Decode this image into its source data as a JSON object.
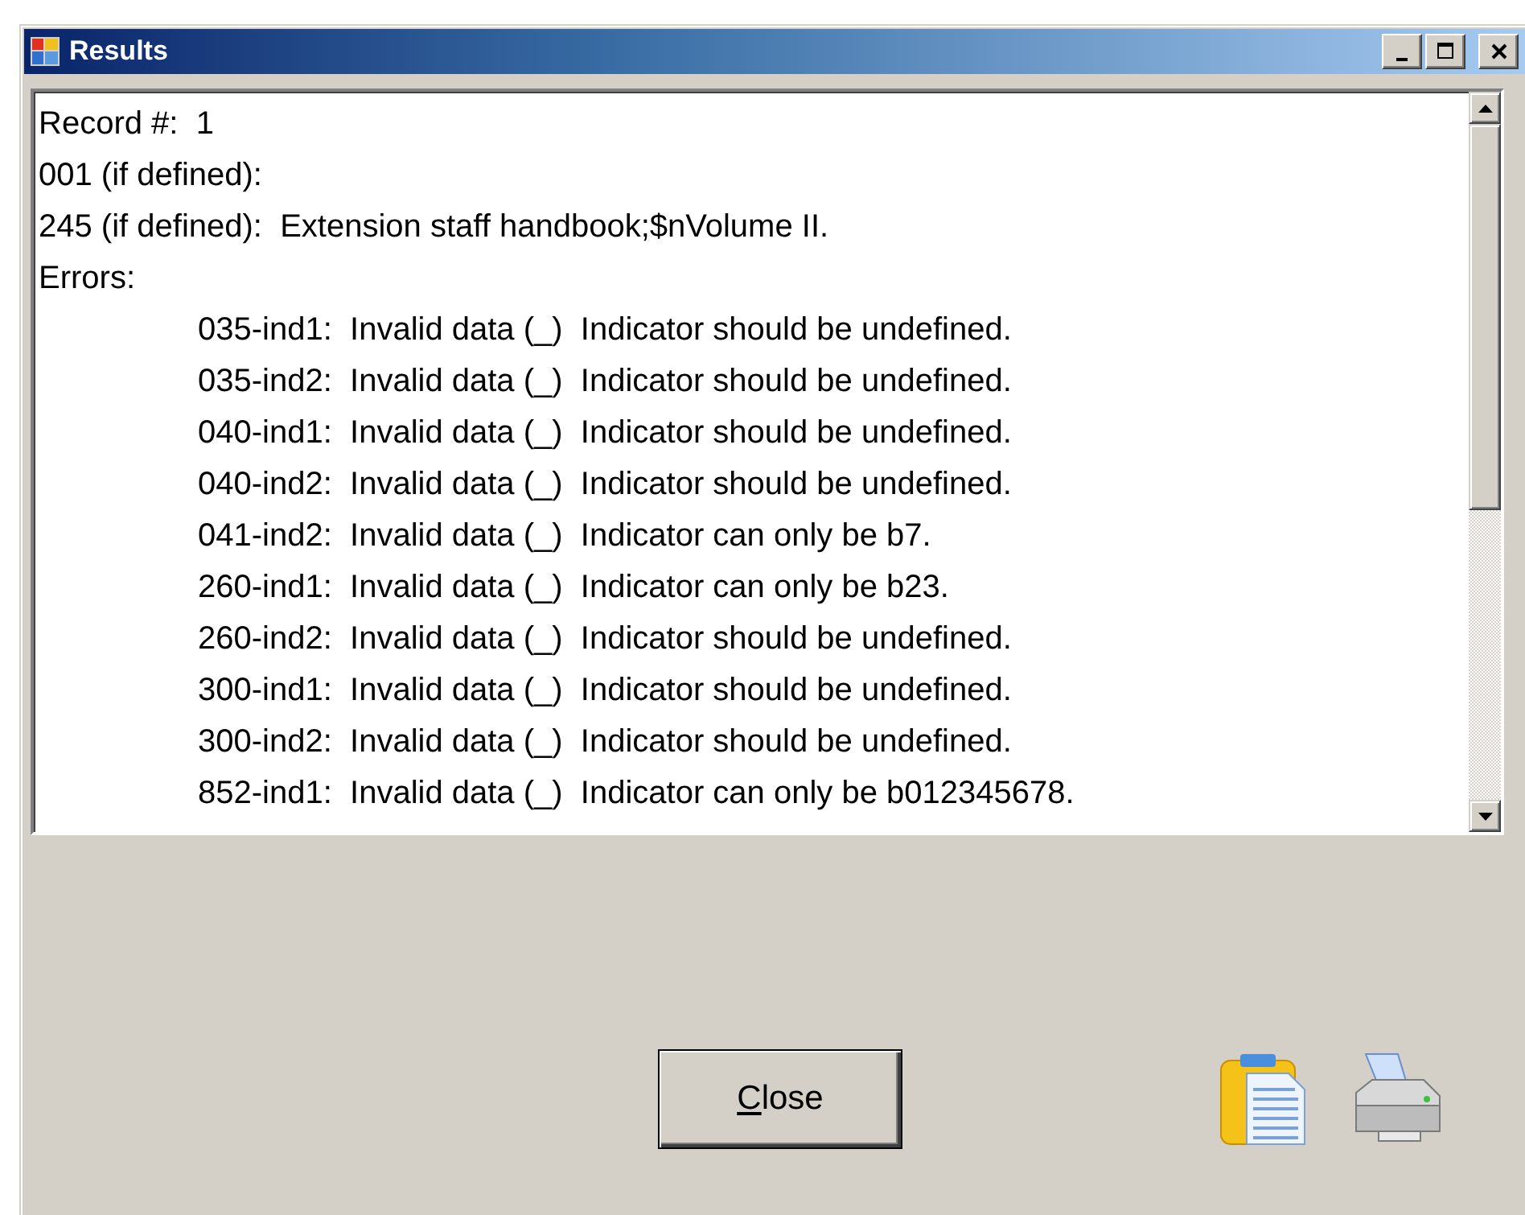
{
  "window": {
    "title": "Results"
  },
  "output": {
    "lines": [
      {
        "kind": "header",
        "text": "Record #:  1"
      },
      {
        "kind": "header",
        "text": "001 (if defined):"
      },
      {
        "kind": "header",
        "text": "245 (if defined):  Extension staff handbook;$nVolume II."
      },
      {
        "kind": "header",
        "text": "Errors:"
      },
      {
        "kind": "error",
        "text": "035-ind1:  Invalid data (_)  Indicator should be undefined."
      },
      {
        "kind": "error",
        "text": "035-ind2:  Invalid data (_)  Indicator should be undefined."
      },
      {
        "kind": "error",
        "text": "040-ind1:  Invalid data (_)  Indicator should be undefined."
      },
      {
        "kind": "error",
        "text": "040-ind2:  Invalid data (_)  Indicator should be undefined."
      },
      {
        "kind": "error",
        "text": "041-ind2:  Invalid data (_)  Indicator can only be b7."
      },
      {
        "kind": "error",
        "text": "260-ind1:  Invalid data (_)  Indicator can only be b23."
      },
      {
        "kind": "error",
        "text": "260-ind2:  Invalid data (_)  Indicator should be undefined."
      },
      {
        "kind": "error",
        "text": "300-ind1:  Invalid data (_)  Indicator should be undefined."
      },
      {
        "kind": "error",
        "text": "300-ind2:  Invalid data (_)  Indicator should be undefined."
      },
      {
        "kind": "error",
        "text": "852-ind1:  Invalid data (_)  Indicator can only be b012345678."
      }
    ]
  },
  "buttons": [
    {
      "label": "Close"
    }
  ]
}
